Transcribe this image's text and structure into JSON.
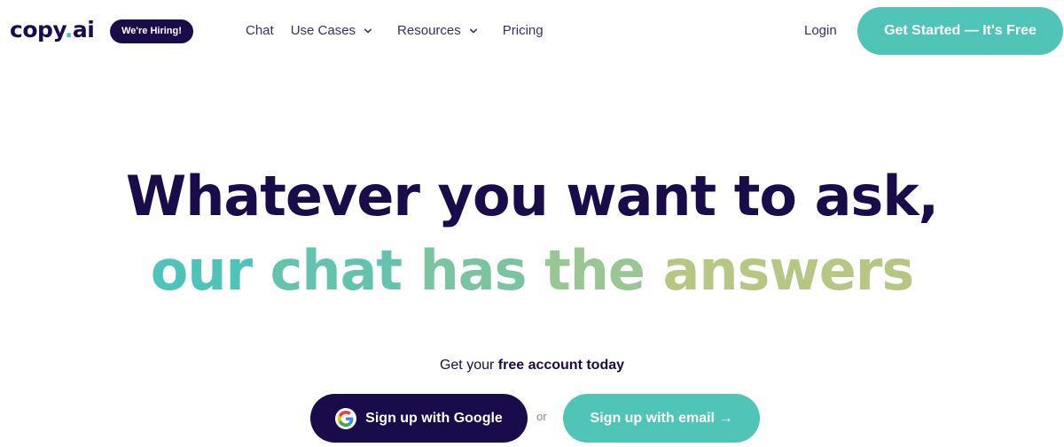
{
  "header": {
    "logo_text": "copy",
    "logo_dot": ".",
    "logo_suffix": "ai",
    "hiring_badge": "We're Hiring!",
    "nav": {
      "chat": "Chat",
      "use_cases": "Use Cases",
      "resources": "Resources",
      "pricing": "Pricing"
    },
    "login": "Login",
    "cta": "Get Started — It's Free"
  },
  "hero": {
    "line1": "Whatever you want to ask,",
    "line2_words": [
      "our",
      "chat",
      "has",
      "the",
      "answers"
    ]
  },
  "signup": {
    "prompt_prefix": "Get your ",
    "prompt_bold": "free account today",
    "google_button": "Sign up with Google",
    "or": "or",
    "email_button": "Sign up with email →"
  },
  "colors": {
    "brand_dark": "#1a0c4b",
    "brand_teal": "#4fc4b7",
    "gradient_end": "#b6c784"
  },
  "icons": {
    "use_cases_chevron": "chevron-down-icon",
    "resources_chevron": "chevron-down-icon",
    "google": "google-icon"
  }
}
